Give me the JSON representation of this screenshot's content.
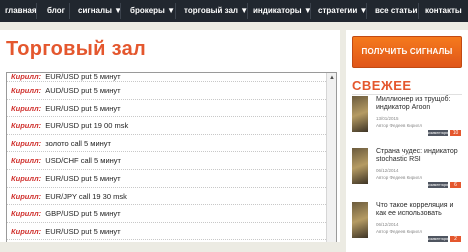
{
  "nav": {
    "items": [
      {
        "label": "главная",
        "dropdown": false
      },
      {
        "label": "блог",
        "dropdown": false
      },
      {
        "label": "сигналы ▼",
        "dropdown": true
      },
      {
        "label": "брокеры ▼",
        "dropdown": true
      },
      {
        "label": "торговый зал ▼",
        "dropdown": true
      },
      {
        "label": "индикаторы ▼",
        "dropdown": true
      },
      {
        "label": "стратегии ▼",
        "dropdown": true
      },
      {
        "label": "все статьи",
        "dropdown": false
      },
      {
        "label": "контакты",
        "dropdown": false
      }
    ]
  },
  "main": {
    "title": "Торговый зал",
    "chat": [
      {
        "author": "Кирилл:",
        "text": "EUR/USD put 5 минут"
      },
      {
        "author": "Кирилл:",
        "text": "AUD/USD put 5 минут"
      },
      {
        "author": "Кирилл:",
        "text": "EUR/USD put 5 минут"
      },
      {
        "author": "Кирилл:",
        "text": "EUR/USD put 19 00 msk"
      },
      {
        "author": "Кирилл:",
        "text": "золото call 5 минут"
      },
      {
        "author": "Кирилл:",
        "text": "USD/CHF call 5 минут"
      },
      {
        "author": "Кирилл:",
        "text": "EUR/USD put 5 минут"
      },
      {
        "author": "Кирилл:",
        "text": "EUR/JPY call 19 30 msk"
      },
      {
        "author": "Кирилл:",
        "text": "GBP/USD put 5 минут"
      },
      {
        "author": "Кирилл:",
        "text": "EUR/USD put 5 минут"
      }
    ],
    "scroll": {
      "up_icon": "▲",
      "down_icon": "▼"
    }
  },
  "sidebar": {
    "cta_label": "ПОЛУЧИТЬ СИГНАЛЫ",
    "section_title": "СВЕЖЕЕ",
    "posts": [
      {
        "title": "Миллионер из трущоб: индикатор Aroon",
        "date": "13/01/2015",
        "author": "Автор Федеев Кирилл",
        "comments_label": "комментарии",
        "count": "10"
      },
      {
        "title": "Страна чудес: индикатор stochastic RSI",
        "date": "06/12/2014",
        "author": "Автор Федеев Кирилл",
        "comments_label": "комментарии",
        "count": "6"
      },
      {
        "title": "Что такое корреляция и как ее использовать",
        "date": "06/12/2014",
        "author": "Автор Федеев Кирилл",
        "comments_label": "комментарии",
        "count": "2"
      }
    ]
  }
}
